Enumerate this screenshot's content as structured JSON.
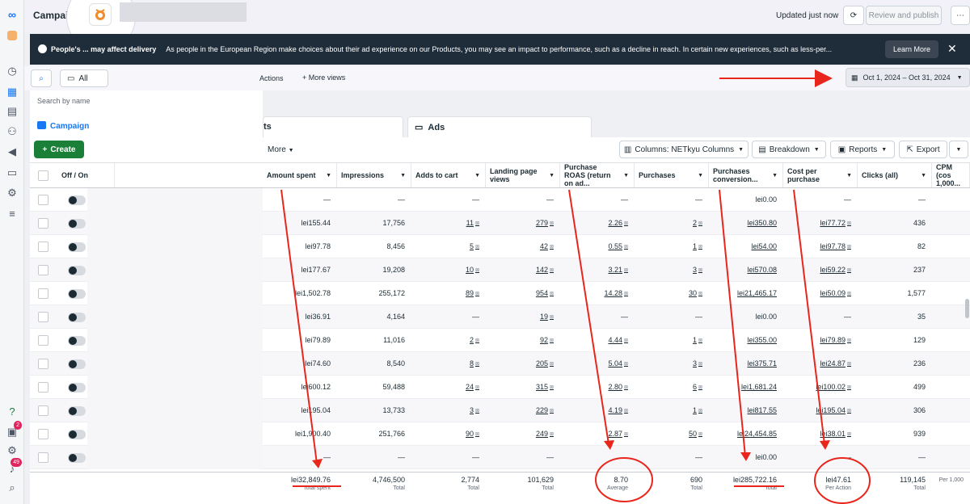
{
  "header": {
    "title": "Campai",
    "updated_text": "Updated just now",
    "review_publish": "Review and publish"
  },
  "notice": {
    "bold": "People's ... may affect delivery",
    "message": "As people in the European Region make choices about their ad experience on our Products, you may see an impact to performance, such as a decline in reach. In certain new experiences, such as less-per...",
    "learn_more": "Learn More"
  },
  "toolbar": {
    "all_label": "All",
    "actions_label": "Actions",
    "more_views": "More views",
    "date_range": "Oct 1, 2024 – Oct 31, 2024"
  },
  "left": {
    "search_placeholder": "Search by name",
    "campaigns_tab": "Campaign",
    "create": "Create",
    "offon": "Off / On"
  },
  "tabs": {
    "adsets_partial": "ts",
    "ads": "Ads"
  },
  "actions_bar": {
    "more": "More",
    "columns": "Columns: NETkyu Columns",
    "breakdown": "Breakdown",
    "reports": "Reports",
    "export": "Export"
  },
  "rail_badges": {
    "notifications": "2",
    "alerts": "49"
  },
  "table": {
    "headers": [
      "Amount spent",
      "Impressions",
      "Adds to cart",
      "Landing page views",
      "Purchase ROAS (return on ad...",
      "Purchases",
      "Purchases conversion...",
      "Cost per purchase",
      "Clicks (all)",
      "CPM (cos 1,000..."
    ],
    "rows": [
      [
        "—",
        "—",
        "—",
        "—",
        "—",
        "—",
        "lei0.00",
        "—",
        "—"
      ],
      [
        "lei155.44",
        "17,756",
        "11",
        "279",
        "2.26",
        "2",
        "lei350.80",
        "lei77.72",
        "436"
      ],
      [
        "lei97.78",
        "8,456",
        "5",
        "42",
        "0.55",
        "1",
        "lei54.00",
        "lei97.78",
        "82"
      ],
      [
        "lei177.67",
        "19,208",
        "10",
        "142",
        "3.21",
        "3",
        "lei570.08",
        "lei59.22",
        "237"
      ],
      [
        "lei1,502.78",
        "255,172",
        "89",
        "954",
        "14.28",
        "30",
        "lei21,465.17",
        "lei50.09",
        "1,577"
      ],
      [
        "lei36.91",
        "4,164",
        "—",
        "19",
        "—",
        "—",
        "lei0.00",
        "—",
        "35"
      ],
      [
        "lei79.89",
        "11,016",
        "2",
        "92",
        "4.44",
        "1",
        "lei355.00",
        "lei79.89",
        "129"
      ],
      [
        "lei74.60",
        "8,540",
        "8",
        "205",
        "5.04",
        "3",
        "lei375.71",
        "lei24.87",
        "236"
      ],
      [
        "lei600.12",
        "59,488",
        "24",
        "315",
        "2.80",
        "6",
        "lei1,681.24",
        "lei100.02",
        "499"
      ],
      [
        "lei195.04",
        "13,733",
        "3",
        "229",
        "4.19",
        "1",
        "lei817.55",
        "lei195.04",
        "306"
      ],
      [
        "lei1,900.40",
        "251,766",
        "90",
        "249",
        "2.87",
        "50",
        "lei24,454.85",
        "lei38.01",
        "939"
      ],
      [
        "—",
        "—",
        "—",
        "—",
        "—",
        "—",
        "lei0.00",
        "—",
        "—"
      ]
    ],
    "totals": [
      {
        "value": "lei32,849.76",
        "label": "Total spent"
      },
      {
        "value": "4,746,500",
        "label": "Total"
      },
      {
        "value": "2,774",
        "label": "Total"
      },
      {
        "value": "101,629",
        "label": "Total"
      },
      {
        "value": "8.70",
        "label": "Average"
      },
      {
        "value": "690",
        "label": "Total"
      },
      {
        "value": "lei285,722.16",
        "label": "Total"
      },
      {
        "value": "lei47.61",
        "label": "Per Action"
      },
      {
        "value": "119,145",
        "label": "Total"
      },
      {
        "value": "",
        "label": "Per 1,000"
      }
    ]
  },
  "colors": {
    "accent": "#1877f2",
    "annotation": "#e8261c",
    "notice_bg": "#1f2d3a",
    "create_green": "#1a7f37"
  }
}
